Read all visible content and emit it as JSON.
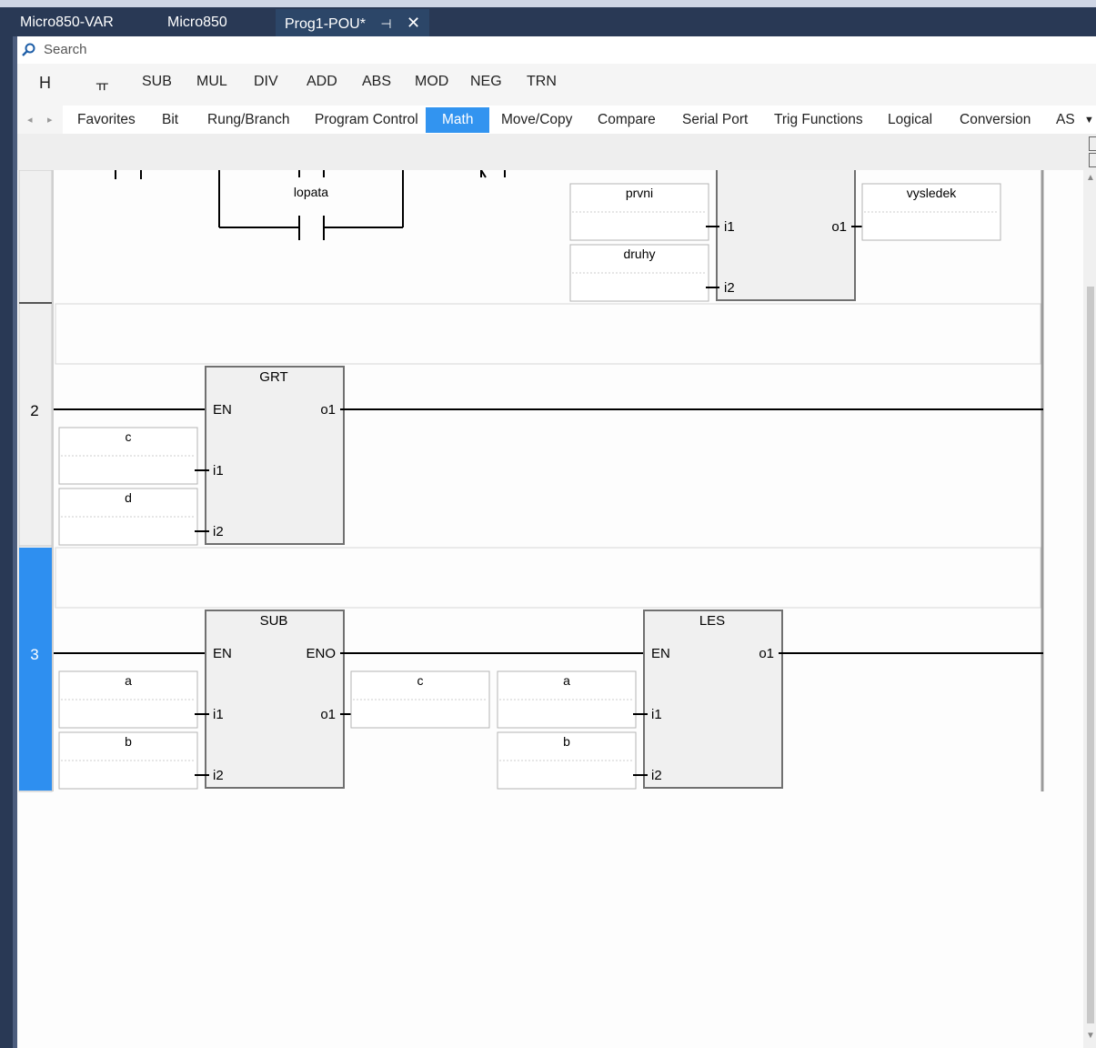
{
  "document_tabs": [
    {
      "label": "Micro850-VAR"
    },
    {
      "label": "Micro850"
    },
    {
      "label": "Prog1-POU*"
    }
  ],
  "icons": {
    "pin": "pin-icon",
    "close": "close-icon",
    "search": "search-icon",
    "scroll_left": "arrow-left-icon",
    "scroll_right": "arrow-right-icon",
    "overflow": "chevron-down-icon",
    "scroll_up": "arrow-up-icon",
    "scroll_down": "arrow-down-icon"
  },
  "search": {
    "placeholder": "Search"
  },
  "quick_toolbar": {
    "rung_symbol": "H",
    "branch_symbol": "ㅠ",
    "items": [
      "SUB",
      "MUL",
      "DIV",
      "ADD",
      "ABS",
      "MOD",
      "NEG",
      "TRN"
    ]
  },
  "categories": {
    "items": [
      "Favorites",
      "Bit",
      "Rung/Branch",
      "Program Control",
      "Math",
      "Move/Copy",
      "Compare",
      "Serial Port",
      "Trig Functions",
      "Logical",
      "Conversion",
      "AS"
    ],
    "selected": "Math"
  },
  "colors": {
    "accent": "#3294f0",
    "title_bar": "#293955",
    "block_fill": "#f0f0f0",
    "wire": "#000000"
  },
  "rung1": {
    "contact_label": "lopata",
    "inputs": [
      {
        "var": "prvni",
        "pin": "i1"
      },
      {
        "var": "druhy",
        "pin": "i2"
      }
    ],
    "output": {
      "var": "vysledek",
      "pin": "o1"
    }
  },
  "rung2": {
    "number": "2",
    "block": {
      "name": "GRT",
      "en": "EN",
      "out": "o1"
    },
    "inputs": [
      {
        "var": "c",
        "pin": "i1"
      },
      {
        "var": "d",
        "pin": "i2"
      }
    ]
  },
  "rung3": {
    "number": "3",
    "block_sub": {
      "name": "SUB",
      "en": "EN",
      "eno": "ENO",
      "out": "o1"
    },
    "sub_inputs": [
      {
        "var": "a",
        "pin": "i1"
      },
      {
        "var": "b",
        "pin": "i2"
      }
    ],
    "sub_output": "c",
    "block_les": {
      "name": "LES",
      "en": "EN",
      "out": "o1"
    },
    "les_inputs": [
      {
        "var": "a",
        "pin": "i1"
      },
      {
        "var": "b",
        "pin": "i2"
      }
    ]
  }
}
